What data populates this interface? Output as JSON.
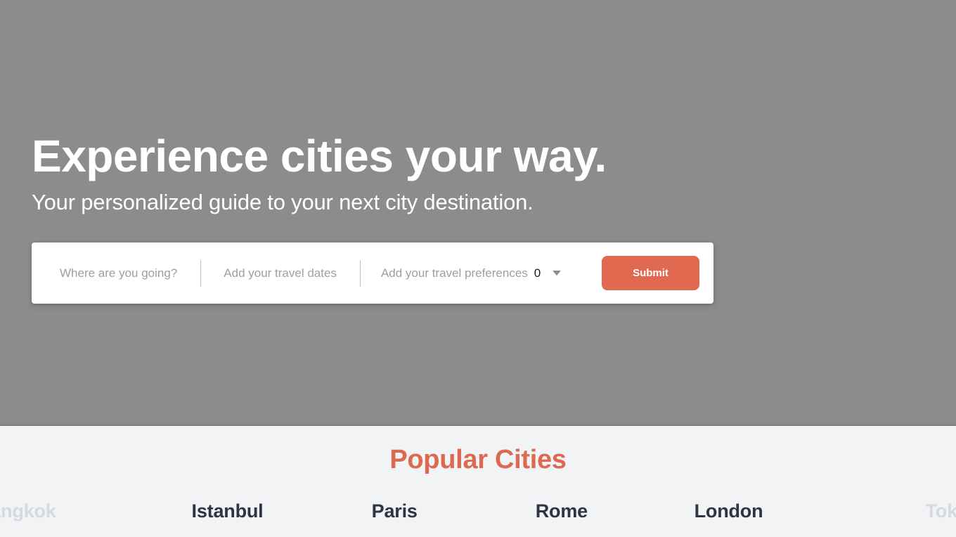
{
  "hero": {
    "title": "Experience cities your way.",
    "subtitle": "Your personalized guide to your next city destination.",
    "background_color": "#8c8c8c"
  },
  "search": {
    "destination_placeholder": "Where are you going?",
    "dates_placeholder": "Add your travel dates",
    "preferences_placeholder": "Add your travel preferences",
    "preferences_count": "0",
    "submit_label": "Submit",
    "accent_color": "#e0694f"
  },
  "popular_cities": {
    "heading": "Popular Cities",
    "heading_color": "#dd6a50",
    "items": [
      {
        "name": "Bangkok",
        "state": "faded"
      },
      {
        "name": "Istanbul",
        "state": "active"
      },
      {
        "name": "Paris",
        "state": "active"
      },
      {
        "name": "Rome",
        "state": "active"
      },
      {
        "name": "London",
        "state": "active"
      },
      {
        "name": "Tokyo",
        "state": "faded"
      }
    ]
  }
}
